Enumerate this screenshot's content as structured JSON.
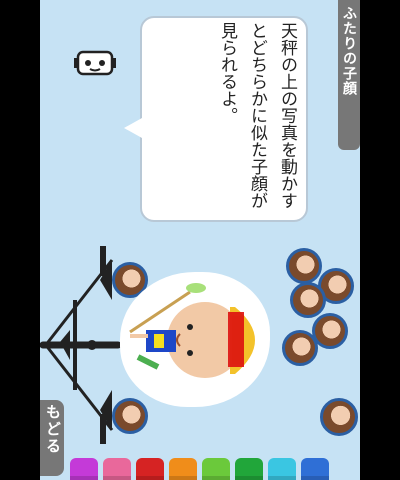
{
  "header": {
    "title": "ふたりの子顔"
  },
  "bubble": {
    "text": "天秤の上の写真を動かすとどちらかに似た子顔が見られるよ。"
  },
  "controls": {
    "back_label": "もどる"
  },
  "crayon_colors": [
    "#c43ad8",
    "#e9689b",
    "#d62323",
    "#f08d1a",
    "#6bc93b",
    "#21a63a",
    "#3ac6e2",
    "#2f6fd6"
  ],
  "icons": {
    "robot": "robot-icon",
    "scale": "balance-scale-icon",
    "child": "child-doll-icon"
  }
}
